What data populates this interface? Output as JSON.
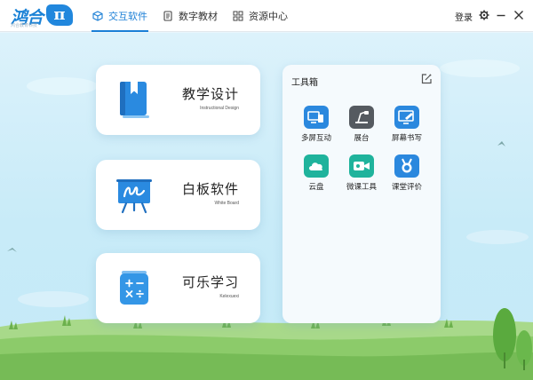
{
  "app": {
    "logo_text": "鸿合",
    "logo_pi": "π",
    "logo_sub": "鸿合教育科技"
  },
  "nav": {
    "tabs": [
      {
        "label": "交互软件",
        "icon": "cube-icon",
        "active": true
      },
      {
        "label": "数字教材",
        "icon": "book-icon",
        "active": false
      },
      {
        "label": "资源中心",
        "icon": "grid-icon",
        "active": false
      }
    ]
  },
  "header": {
    "login": "登录",
    "settings_icon": "gear-icon",
    "minimize_icon": "minimize-icon",
    "close_icon": "close-icon"
  },
  "cards": [
    {
      "title": "教学设计",
      "subtitle": "Instructional Design",
      "icon": "notebook-icon",
      "color": "#2a8ae0"
    },
    {
      "title": "白板软件",
      "subtitle": "White Board",
      "icon": "whiteboard-icon",
      "color": "#2a8ae0"
    },
    {
      "title": "可乐学习",
      "subtitle": "Kelexuexi",
      "icon": "math-can-icon",
      "color": "#3496e6"
    }
  ],
  "toolbox": {
    "title": "工具箱",
    "edit_icon": "edit-icon",
    "tools": [
      {
        "label": "多屏互动",
        "icon": "multiscreen-icon",
        "color": "#2b88de"
      },
      {
        "label": "展台",
        "icon": "document-camera-icon",
        "color": "#555a60"
      },
      {
        "label": "屏幕书写",
        "icon": "screen-pen-icon",
        "color": "#2b88de"
      },
      {
        "label": "云盘",
        "icon": "cloud-icon",
        "color": "#1fb39c"
      },
      {
        "label": "微课工具",
        "icon": "video-camera-icon",
        "color": "#1fb39c"
      },
      {
        "label": "课堂评价",
        "icon": "medal-icon",
        "color": "#2b88de"
      }
    ]
  },
  "colors": {
    "accent": "#1b7fd6",
    "sky": "#c8ebf8",
    "grass": "#7bc15c"
  }
}
